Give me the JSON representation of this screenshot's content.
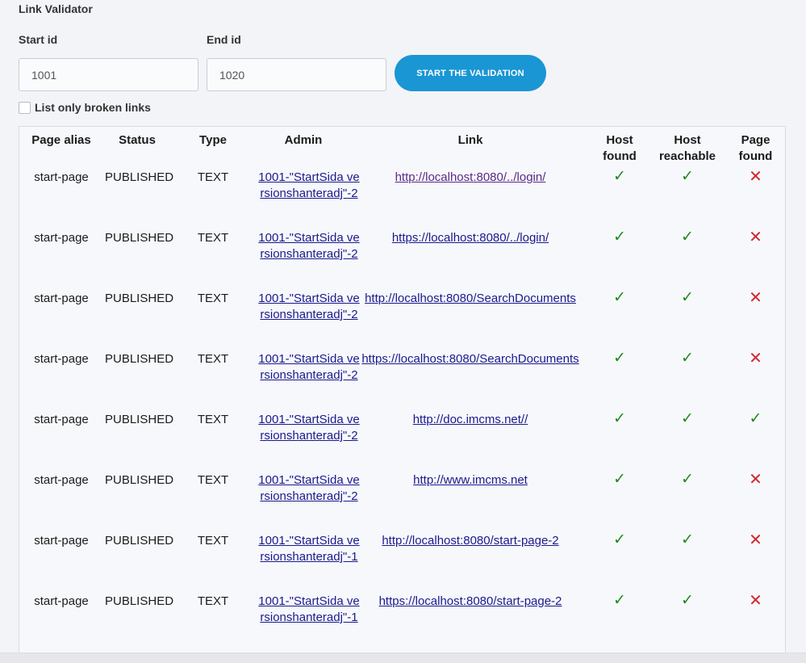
{
  "app": {
    "title": "Link Validator"
  },
  "form": {
    "start_label": "Start id",
    "end_label": "End id",
    "start_value": "1001",
    "end_value": "1020",
    "button_label": "START THE VALIDATION",
    "broken_only_label": "List only broken links",
    "broken_only_checked": false
  },
  "table": {
    "columns": [
      "Page alias",
      "Status",
      "Type",
      "Admin",
      "Link",
      "Host found",
      "Host reachable",
      "Page found"
    ],
    "rows": [
      {
        "alias": "start-page",
        "status": "PUBLISHED",
        "type": "TEXT",
        "admin": "1001-\"StartSida versionshanteradj\"-2",
        "link": "http://localhost:8080/../login/",
        "host_found": true,
        "host_reachable": true,
        "page_found": false
      },
      {
        "alias": "start-page",
        "status": "PUBLISHED",
        "type": "TEXT",
        "admin": "1001-\"StartSida versionshanteradj\"-2",
        "link": "https://localhost:8080/../login/",
        "host_found": true,
        "host_reachable": true,
        "page_found": false
      },
      {
        "alias": "start-page",
        "status": "PUBLISHED",
        "type": "TEXT",
        "admin": "1001-\"StartSida versionshanteradj\"-2",
        "link": "http://localhost:8080/SearchDocuments",
        "host_found": true,
        "host_reachable": true,
        "page_found": false
      },
      {
        "alias": "start-page",
        "status": "PUBLISHED",
        "type": "TEXT",
        "admin": "1001-\"StartSida versionshanteradj\"-2",
        "link": "https://localhost:8080/SearchDocuments",
        "host_found": true,
        "host_reachable": true,
        "page_found": false
      },
      {
        "alias": "start-page",
        "status": "PUBLISHED",
        "type": "TEXT",
        "admin": "1001-\"StartSida versionshanteradj\"-2",
        "link": "http://doc.imcms.net//",
        "host_found": true,
        "host_reachable": true,
        "page_found": true
      },
      {
        "alias": "start-page",
        "status": "PUBLISHED",
        "type": "TEXT",
        "admin": "1001-\"StartSida versionshanteradj\"-2",
        "link": "http://www.imcms.net",
        "host_found": true,
        "host_reachable": true,
        "page_found": false
      },
      {
        "alias": "start-page",
        "status": "PUBLISHED",
        "type": "TEXT",
        "admin": "1001-\"StartSida versionshanteradj\"-1",
        "link": "http://localhost:8080/start-page-2",
        "host_found": true,
        "host_reachable": true,
        "page_found": false
      },
      {
        "alias": "start-page",
        "status": "PUBLISHED",
        "type": "TEXT",
        "admin": "1001-\"StartSida versionshanteradj\"-1",
        "link": "https://localhost:8080/start-page-2",
        "host_found": true,
        "host_reachable": true,
        "page_found": false
      }
    ]
  },
  "icons": {
    "ok": "check-icon",
    "fail": "cross-icon"
  },
  "colors": {
    "button": "#1a96d4",
    "ok": "#1f8a1f",
    "fail": "#d0282e",
    "link": "#1a1a8c"
  }
}
